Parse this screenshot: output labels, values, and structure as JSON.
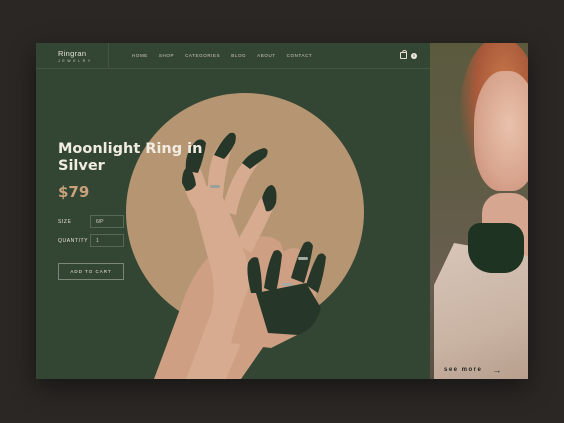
{
  "brand": {
    "name": "Ringran",
    "tagline": "JEWELRY"
  },
  "nav": {
    "items": [
      "HOME",
      "SHOP",
      "CATEGORIES",
      "BLOG",
      "ABOUT",
      "CONTACT"
    ],
    "cart_count": "0"
  },
  "product": {
    "title": "Moonlight Ring in Silver",
    "price": "$79",
    "size_label": "SIZE",
    "size_value": "6/P",
    "quantity_label": "QUANTITY",
    "quantity_value": "1",
    "add_to_cart": "ADD TO CART"
  },
  "side": {
    "see_more": "see more"
  },
  "colors": {
    "background": "#2a2724",
    "panel": "#334634",
    "circle": "#b59572",
    "price": "#c7a27b",
    "text": "#f1ece2"
  }
}
